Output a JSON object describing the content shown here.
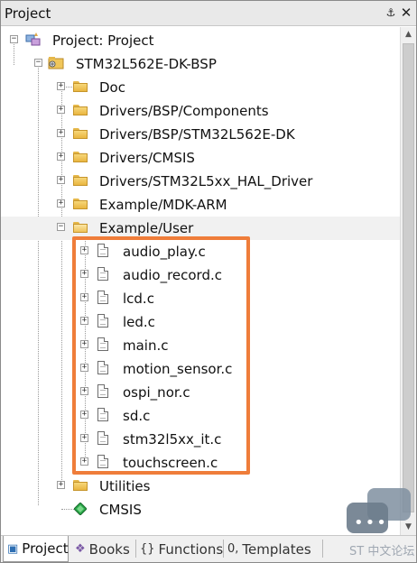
{
  "panel": {
    "title": "Project"
  },
  "tree": {
    "root": "Project: Project",
    "target": "STM32L562E-DK-BSP",
    "groups_before": [
      "Doc",
      "Drivers/BSP/Components",
      "Drivers/BSP/STM32L562E-DK",
      "Drivers/CMSIS",
      "Drivers/STM32L5xx_HAL_Driver",
      "Example/MDK-ARM"
    ],
    "open_group": "Example/User",
    "files": [
      "audio_play.c",
      "audio_record.c",
      "lcd.c",
      "led.c",
      "main.c",
      "motion_sensor.c",
      "ospi_nor.c",
      "sd.c",
      "stm32l5xx_it.c",
      "touchscreen.c"
    ],
    "utilities": "Utilities",
    "cmsis": "CMSIS"
  },
  "tabs": [
    {
      "label": "Project",
      "icon": "project-icon",
      "active": true
    },
    {
      "label": "Books",
      "icon": "books-icon"
    },
    {
      "label": "Functions",
      "icon": "functions-icon"
    },
    {
      "label": "Templates",
      "icon": "templates-icon"
    }
  ],
  "watermark": "ST 中文论坛",
  "colors": {
    "highlight": "#ef7d3a",
    "folder": "#f0c65a"
  }
}
